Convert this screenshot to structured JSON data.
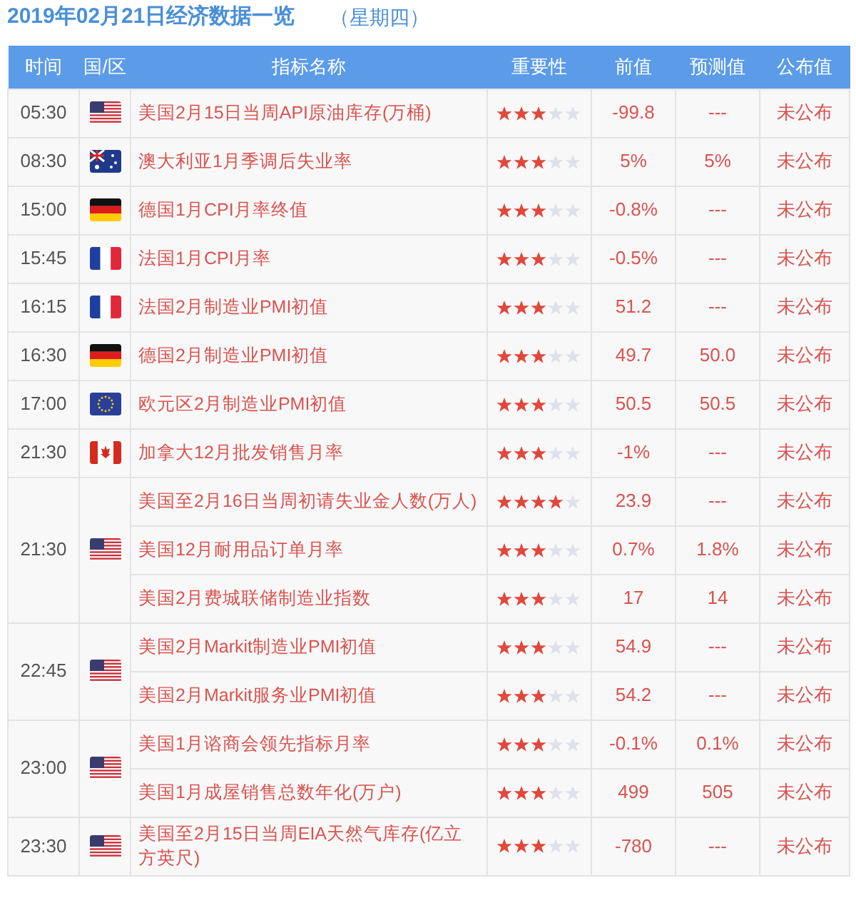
{
  "title": "2019年02月21日经济数据一览",
  "weekday": "（星期四）",
  "columns": [
    "时间",
    "国/区",
    "指标名称",
    "重要性",
    "前值",
    "预测值",
    "公布值"
  ],
  "groups": [
    {
      "time": "05:30",
      "kind": "us",
      "events": [
        {
          "name": "美国2月15日当周API原油库存(万桶)",
          "stars": 3,
          "previous": "-99.8",
          "forecast": "---",
          "actual": "未公布"
        }
      ]
    },
    {
      "time": "08:30",
      "kind": "au",
      "events": [
        {
          "name": "澳大利亚1月季调后失业率",
          "stars": 3,
          "previous": "5%",
          "forecast": "5%",
          "actual": "未公布"
        }
      ]
    },
    {
      "time": "15:00",
      "kind": "de",
      "events": [
        {
          "name": "德国1月CPI月率终值",
          "stars": 3,
          "previous": "-0.8%",
          "forecast": "---",
          "actual": "未公布"
        }
      ]
    },
    {
      "time": "15:45",
      "kind": "fr",
      "events": [
        {
          "name": "法国1月CPI月率",
          "stars": 3,
          "previous": "-0.5%",
          "forecast": "---",
          "actual": "未公布"
        }
      ]
    },
    {
      "time": "16:15",
      "kind": "fr",
      "events": [
        {
          "name": "法国2月制造业PMI初值",
          "stars": 3,
          "previous": "51.2",
          "forecast": "---",
          "actual": "未公布"
        }
      ]
    },
    {
      "time": "16:30",
      "kind": "de",
      "events": [
        {
          "name": "德国2月制造业PMI初值",
          "stars": 3,
          "previous": "49.7",
          "forecast": "50.0",
          "actual": "未公布"
        }
      ]
    },
    {
      "time": "17:00",
      "kind": "eu",
      "events": [
        {
          "name": "欧元区2月制造业PMI初值",
          "stars": 3,
          "previous": "50.5",
          "forecast": "50.5",
          "actual": "未公布"
        }
      ]
    },
    {
      "time": "21:30",
      "kind": "ca",
      "events": [
        {
          "name": "加拿大12月批发销售月率",
          "stars": 3,
          "previous": "-1%",
          "forecast": "---",
          "actual": "未公布"
        }
      ]
    },
    {
      "time": "21:30",
      "kind": "us",
      "events": [
        {
          "name": "美国至2月16日当周初请失业金人数(万人)",
          "stars": 4,
          "previous": "23.9",
          "forecast": "---",
          "actual": "未公布"
        },
        {
          "name": "美国12月耐用品订单月率",
          "stars": 3,
          "previous": "0.7%",
          "forecast": "1.8%",
          "actual": "未公布"
        },
        {
          "name": "美国2月费城联储制造业指数",
          "stars": 3,
          "previous": "17",
          "forecast": "14",
          "actual": "未公布"
        }
      ]
    },
    {
      "time": "22:45",
      "kind": "us",
      "events": [
        {
          "name": "美国2月Markit制造业PMI初值",
          "stars": 3,
          "previous": "54.9",
          "forecast": "---",
          "actual": "未公布"
        },
        {
          "name": "美国2月Markit服务业PMI初值",
          "stars": 3,
          "previous": "54.2",
          "forecast": "---",
          "actual": "未公布"
        }
      ]
    },
    {
      "time": "23:00",
      "kind": "us",
      "events": [
        {
          "name": "美国1月谘商会领先指标月率",
          "stars": 3,
          "previous": "-0.1%",
          "forecast": "0.1%",
          "actual": "未公布"
        },
        {
          "name": "美国1月成屋销售总数年化(万户)",
          "stars": 3,
          "previous": "499",
          "forecast": "505",
          "actual": "未公布"
        }
      ]
    },
    {
      "time": "23:30",
      "kind": "us",
      "events": [
        {
          "name": "美国至2月15日当周EIA天然气库存(亿立方英尺)",
          "stars": 3,
          "previous": "-780",
          "forecast": "---",
          "actual": "未公布"
        }
      ]
    }
  ]
}
